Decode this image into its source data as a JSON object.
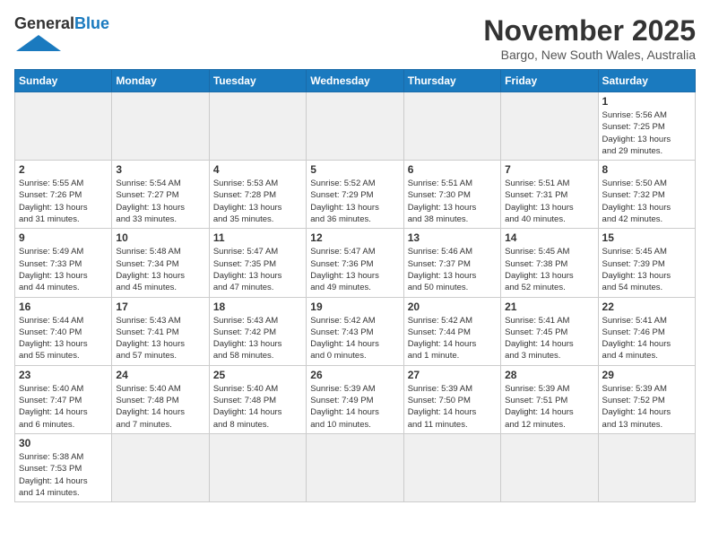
{
  "header": {
    "logo_general": "General",
    "logo_blue": "Blue",
    "month_title": "November 2025",
    "location": "Bargo, New South Wales, Australia"
  },
  "days_of_week": [
    "Sunday",
    "Monday",
    "Tuesday",
    "Wednesday",
    "Thursday",
    "Friday",
    "Saturday"
  ],
  "weeks": [
    [
      {
        "day": "",
        "info": ""
      },
      {
        "day": "",
        "info": ""
      },
      {
        "day": "",
        "info": ""
      },
      {
        "day": "",
        "info": ""
      },
      {
        "day": "",
        "info": ""
      },
      {
        "day": "",
        "info": ""
      },
      {
        "day": "1",
        "info": "Sunrise: 5:56 AM\nSunset: 7:25 PM\nDaylight: 13 hours\nand 29 minutes."
      }
    ],
    [
      {
        "day": "2",
        "info": "Sunrise: 5:55 AM\nSunset: 7:26 PM\nDaylight: 13 hours\nand 31 minutes."
      },
      {
        "day": "3",
        "info": "Sunrise: 5:54 AM\nSunset: 7:27 PM\nDaylight: 13 hours\nand 33 minutes."
      },
      {
        "day": "4",
        "info": "Sunrise: 5:53 AM\nSunset: 7:28 PM\nDaylight: 13 hours\nand 35 minutes."
      },
      {
        "day": "5",
        "info": "Sunrise: 5:52 AM\nSunset: 7:29 PM\nDaylight: 13 hours\nand 36 minutes."
      },
      {
        "day": "6",
        "info": "Sunrise: 5:51 AM\nSunset: 7:30 PM\nDaylight: 13 hours\nand 38 minutes."
      },
      {
        "day": "7",
        "info": "Sunrise: 5:51 AM\nSunset: 7:31 PM\nDaylight: 13 hours\nand 40 minutes."
      },
      {
        "day": "8",
        "info": "Sunrise: 5:50 AM\nSunset: 7:32 PM\nDaylight: 13 hours\nand 42 minutes."
      }
    ],
    [
      {
        "day": "9",
        "info": "Sunrise: 5:49 AM\nSunset: 7:33 PM\nDaylight: 13 hours\nand 44 minutes."
      },
      {
        "day": "10",
        "info": "Sunrise: 5:48 AM\nSunset: 7:34 PM\nDaylight: 13 hours\nand 45 minutes."
      },
      {
        "day": "11",
        "info": "Sunrise: 5:47 AM\nSunset: 7:35 PM\nDaylight: 13 hours\nand 47 minutes."
      },
      {
        "day": "12",
        "info": "Sunrise: 5:47 AM\nSunset: 7:36 PM\nDaylight: 13 hours\nand 49 minutes."
      },
      {
        "day": "13",
        "info": "Sunrise: 5:46 AM\nSunset: 7:37 PM\nDaylight: 13 hours\nand 50 minutes."
      },
      {
        "day": "14",
        "info": "Sunrise: 5:45 AM\nSunset: 7:38 PM\nDaylight: 13 hours\nand 52 minutes."
      },
      {
        "day": "15",
        "info": "Sunrise: 5:45 AM\nSunset: 7:39 PM\nDaylight: 13 hours\nand 54 minutes."
      }
    ],
    [
      {
        "day": "16",
        "info": "Sunrise: 5:44 AM\nSunset: 7:40 PM\nDaylight: 13 hours\nand 55 minutes."
      },
      {
        "day": "17",
        "info": "Sunrise: 5:43 AM\nSunset: 7:41 PM\nDaylight: 13 hours\nand 57 minutes."
      },
      {
        "day": "18",
        "info": "Sunrise: 5:43 AM\nSunset: 7:42 PM\nDaylight: 13 hours\nand 58 minutes."
      },
      {
        "day": "19",
        "info": "Sunrise: 5:42 AM\nSunset: 7:43 PM\nDaylight: 14 hours\nand 0 minutes."
      },
      {
        "day": "20",
        "info": "Sunrise: 5:42 AM\nSunset: 7:44 PM\nDaylight: 14 hours\nand 1 minute."
      },
      {
        "day": "21",
        "info": "Sunrise: 5:41 AM\nSunset: 7:45 PM\nDaylight: 14 hours\nand 3 minutes."
      },
      {
        "day": "22",
        "info": "Sunrise: 5:41 AM\nSunset: 7:46 PM\nDaylight: 14 hours\nand 4 minutes."
      }
    ],
    [
      {
        "day": "23",
        "info": "Sunrise: 5:40 AM\nSunset: 7:47 PM\nDaylight: 14 hours\nand 6 minutes."
      },
      {
        "day": "24",
        "info": "Sunrise: 5:40 AM\nSunset: 7:48 PM\nDaylight: 14 hours\nand 7 minutes."
      },
      {
        "day": "25",
        "info": "Sunrise: 5:40 AM\nSunset: 7:48 PM\nDaylight: 14 hours\nand 8 minutes."
      },
      {
        "day": "26",
        "info": "Sunrise: 5:39 AM\nSunset: 7:49 PM\nDaylight: 14 hours\nand 10 minutes."
      },
      {
        "day": "27",
        "info": "Sunrise: 5:39 AM\nSunset: 7:50 PM\nDaylight: 14 hours\nand 11 minutes."
      },
      {
        "day": "28",
        "info": "Sunrise: 5:39 AM\nSunset: 7:51 PM\nDaylight: 14 hours\nand 12 minutes."
      },
      {
        "day": "29",
        "info": "Sunrise: 5:39 AM\nSunset: 7:52 PM\nDaylight: 14 hours\nand 13 minutes."
      }
    ],
    [
      {
        "day": "30",
        "info": "Sunrise: 5:38 AM\nSunset: 7:53 PM\nDaylight: 14 hours\nand 14 minutes."
      },
      {
        "day": "",
        "info": ""
      },
      {
        "day": "",
        "info": ""
      },
      {
        "day": "",
        "info": ""
      },
      {
        "day": "",
        "info": ""
      },
      {
        "day": "",
        "info": ""
      },
      {
        "day": "",
        "info": ""
      }
    ]
  ]
}
